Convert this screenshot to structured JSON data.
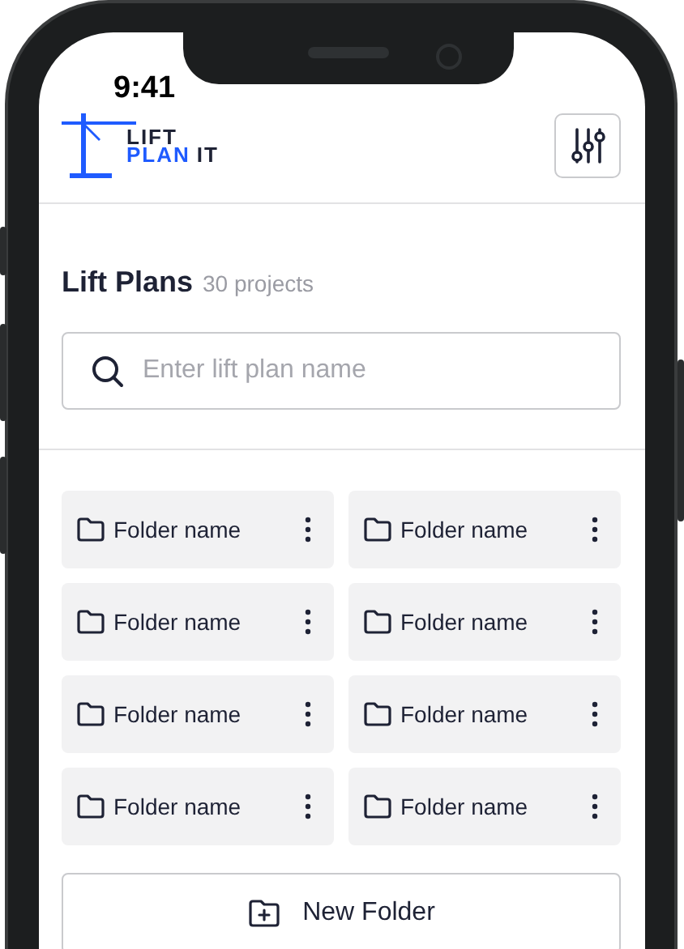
{
  "status_bar": {
    "time": "9:41"
  },
  "logo": {
    "line_1": "LIFT",
    "line_2_accent": "PLAN",
    "line_2_rest": "IT"
  },
  "header": {
    "title": "Lift Plans",
    "count": "30 projects"
  },
  "search": {
    "placeholder": "Enter lift plan name"
  },
  "folders": [
    {
      "name": "Folder name"
    },
    {
      "name": "Folder name"
    },
    {
      "name": "Folder name"
    },
    {
      "name": "Folder name"
    },
    {
      "name": "Folder name"
    },
    {
      "name": "Folder name"
    },
    {
      "name": "Folder name"
    },
    {
      "name": "Folder name"
    }
  ],
  "new_folder_button": {
    "label": "New Folder"
  }
}
